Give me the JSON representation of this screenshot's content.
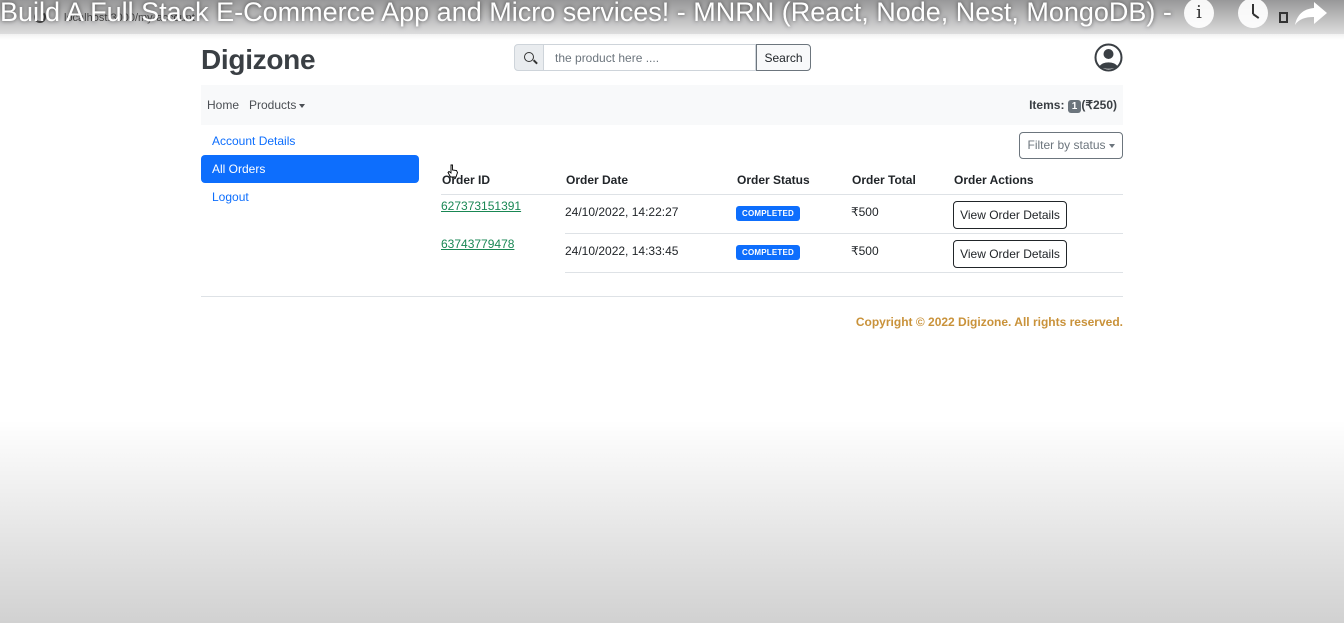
{
  "video": {
    "title": "Build A Full Stack E-Commerce App and Micro services! - MNRN (React, Node, Nest, MongoDB) - ...",
    "url": "localhost:3000/my-account"
  },
  "header": {
    "brand": "Digizone",
    "search_placeholder": "the product here ....",
    "search_button": "Search"
  },
  "nav": {
    "home": "Home",
    "products": "Products",
    "cart_label": "Items:",
    "cart_count": "1",
    "cart_total": "(₹250)"
  },
  "sidebar": {
    "items": [
      {
        "label": "Account Details"
      },
      {
        "label": "All Orders"
      },
      {
        "label": "Logout"
      }
    ]
  },
  "orders": {
    "filter_label": "Filter by status",
    "columns": [
      "Order ID",
      "Order Date",
      "Order Status",
      "Order Total",
      "Order Actions"
    ],
    "rows": [
      {
        "id": "627373151391",
        "date": "24/10/2022, 14:22:27",
        "status": "COMPLETED",
        "total": "₹500",
        "action": "View Order Details"
      },
      {
        "id": "63743779478",
        "date": "24/10/2022, 14:33:45",
        "status": "COMPLETED",
        "total": "₹500",
        "action": "View Order Details"
      }
    ]
  },
  "footer": {
    "copyright": "Copyright © 2022 Digizone. All rights reserved."
  },
  "colors": {
    "primary": "#0d6efd",
    "success_link": "#198754",
    "footer_text": "#c9923a"
  }
}
